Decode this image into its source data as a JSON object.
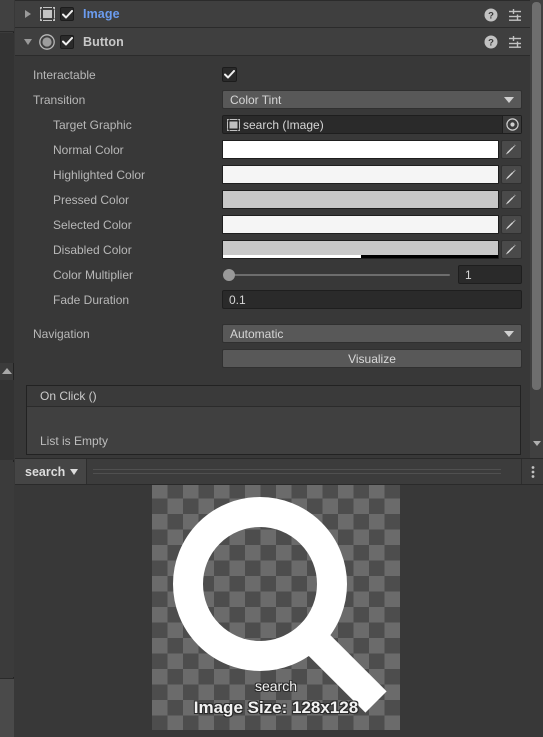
{
  "components": [
    {
      "name": "Image",
      "expanded": false,
      "enabled": true,
      "icon": "image-component-icon",
      "accent": true
    },
    {
      "name": "Button",
      "expanded": true,
      "enabled": true,
      "icon": "button-component-icon",
      "accent": false
    }
  ],
  "header_icons": {
    "help": "help-icon",
    "preset": "preset-settings-icon",
    "menu": "kebab-menu-icon"
  },
  "button_component": {
    "interactable": {
      "label": "Interactable",
      "checked": true
    },
    "transition": {
      "label": "Transition",
      "value": "Color Tint"
    },
    "target_graphic": {
      "label": "Target Graphic",
      "value": "search (Image)",
      "icon": "image-asset-icon"
    },
    "normal_color": {
      "label": "Normal Color",
      "color": "#FFFFFF",
      "alpha": 1
    },
    "highlighted_color": {
      "label": "Highlighted Color",
      "color": "#F5F5F5",
      "alpha": 1
    },
    "pressed_color": {
      "label": "Pressed Color",
      "color": "#C8C8C8",
      "alpha": 1
    },
    "selected_color": {
      "label": "Selected Color",
      "color": "#F5F5F5",
      "alpha": 1
    },
    "disabled_color": {
      "label": "Disabled Color",
      "color": "#C8C8C8",
      "alpha": 0.5
    },
    "color_multiplier": {
      "label": "Color Multiplier",
      "value": "1",
      "slider_percent": 0
    },
    "fade_duration": {
      "label": "Fade Duration",
      "value": "0.1"
    },
    "navigation": {
      "label": "Navigation",
      "value": "Automatic"
    },
    "visualize_button": "Visualize",
    "on_click": {
      "title": "On Click ()",
      "empty_text": "List is Empty"
    }
  },
  "preview": {
    "selector_label": "search",
    "asset_name": "search",
    "image_size_text": "Image Size: 128x128",
    "kebab": "preview-menu-icon"
  }
}
